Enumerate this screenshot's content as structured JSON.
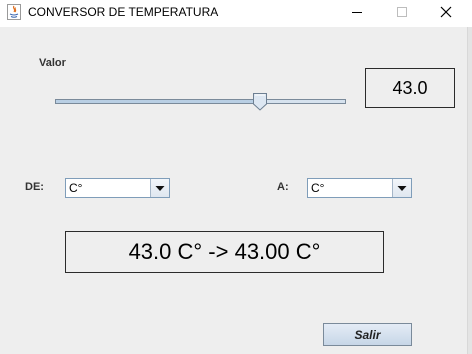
{
  "window": {
    "title": "CONVERSOR DE TEMPERATURA"
  },
  "value_label": "Valor",
  "value_display": "43.0",
  "slider": {
    "value": 43,
    "min": -100,
    "max": 100
  },
  "from": {
    "label": "DE:",
    "selected": "C°"
  },
  "to": {
    "label": "A:",
    "selected": "C°"
  },
  "result": "43.0 C° -> 43.00 C°",
  "exit_button": "Salir",
  "icons": [
    "java-app-icon",
    "minimize-icon",
    "maximize-icon",
    "close-icon",
    "chevron-down-icon"
  ]
}
